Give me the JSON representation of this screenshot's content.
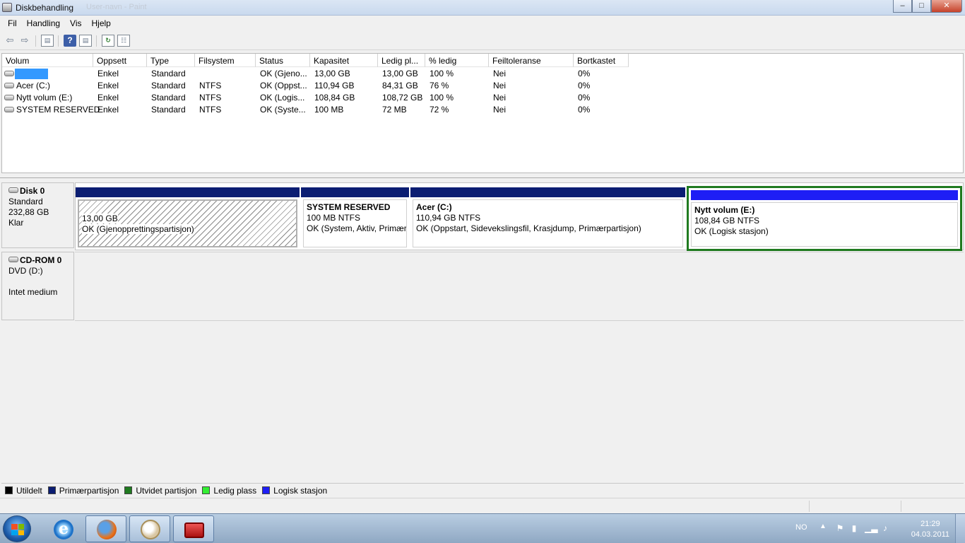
{
  "window": {
    "title": "Diskbehandling",
    "ghost_title": "User-navn - Paint",
    "minimize": "–",
    "maximize": "□",
    "close": "✕"
  },
  "menu": [
    "Fil",
    "Handling",
    "Vis",
    "Hjelp"
  ],
  "toolbar": {
    "icons": [
      "back-icon",
      "forward-icon",
      "console-tree-icon",
      "help-icon",
      "properties-icon",
      "refresh-icon",
      "rescan-icon"
    ]
  },
  "volume_list": {
    "columns": [
      "Volum",
      "Oppsett",
      "Type",
      "Filsystem",
      "Status",
      "Kapasitet",
      "Ledig pl...",
      "% ledig",
      "Feiltoleranse",
      "Bortkastet"
    ],
    "rows": [
      {
        "volum": "",
        "oppsett": "Enkel",
        "type": "Standard",
        "filsystem": "",
        "status": "OK (Gjeno...",
        "kapasitet": "13,00 GB",
        "ledig": "13,00 GB",
        "prosent": "100 %",
        "feil": "Nei",
        "bortkastet": "0%"
      },
      {
        "volum": "Acer (C:)",
        "oppsett": "Enkel",
        "type": "Standard",
        "filsystem": "NTFS",
        "status": "OK (Oppst...",
        "kapasitet": "110,94 GB",
        "ledig": "84,31 GB",
        "prosent": "76 %",
        "feil": "Nei",
        "bortkastet": "0%"
      },
      {
        "volum": "Nytt volum (E:)",
        "oppsett": "Enkel",
        "type": "Standard",
        "filsystem": "NTFS",
        "status": "OK (Logis...",
        "kapasitet": "108,84 GB",
        "ledig": "108,72 GB",
        "prosent": "100 %",
        "feil": "Nei",
        "bortkastet": "0%"
      },
      {
        "volum": "SYSTEM RESERVED",
        "oppsett": "Enkel",
        "type": "Standard",
        "filsystem": "NTFS",
        "status": "OK (Syste...",
        "kapasitet": "100 MB",
        "ledig": "72 MB",
        "prosent": "72 %",
        "feil": "Nei",
        "bortkastet": "0%"
      }
    ]
  },
  "disk0": {
    "name": "Disk 0",
    "type": "Standard",
    "size": "232,88 GB",
    "state": "Klar",
    "partitions": [
      {
        "name": "",
        "size": "13,00 GB",
        "status": "OK (Gjenopprettingspartisjon)"
      },
      {
        "name": "SYSTEM RESERVED",
        "size": "100 MB NTFS",
        "status": "OK (System, Aktiv, Primær"
      },
      {
        "name": "Acer  (C:)",
        "size": "110,94 GB NTFS",
        "status": "OK (Oppstart, Sidevekslingsfil, Krasjdump, Primærpartisjon)"
      },
      {
        "name": "Nytt volum  (E:)",
        "size": "108,84 GB NTFS",
        "status": "OK (Logisk stasjon)"
      }
    ]
  },
  "cdrom0": {
    "name": "CD-ROM 0",
    "drive": "DVD (D:)",
    "media": "Intet medium"
  },
  "legend": [
    {
      "label": "Utildelt",
      "color": "#000000"
    },
    {
      "label": "Primærpartisjon",
      "color": "#0b1d72"
    },
    {
      "label": "Utvidet partisjon",
      "color": "#1f7a1f"
    },
    {
      "label": "Ledig plass",
      "color": "#33ee33"
    },
    {
      "label": "Logisk stasjon",
      "color": "#1e1ef5"
    }
  ],
  "taskbar": {
    "language": "NO",
    "time": "21:29",
    "date": "04.03.2011",
    "apps": [
      "internet-explorer-icon",
      "firefox-icon",
      "paint-icon",
      "computer-management-icon"
    ]
  }
}
